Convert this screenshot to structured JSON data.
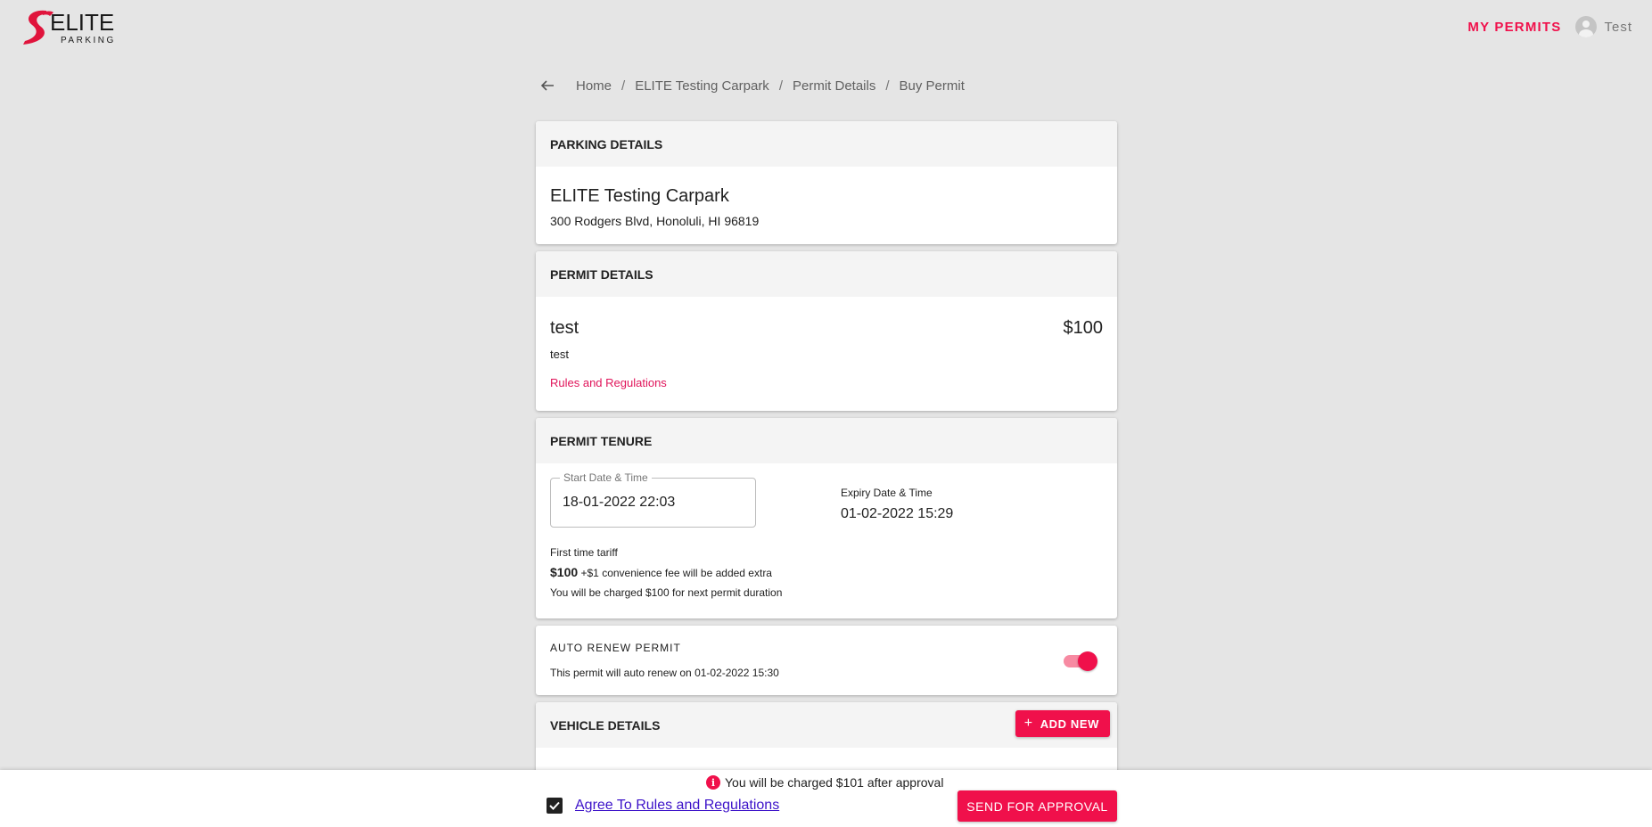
{
  "brand": {
    "logo_word": "ELITE",
    "logo_sub": "PARKING",
    "accent": "#f0104b"
  },
  "header": {
    "nav_link": "MY PERMITS",
    "user_name": "Test",
    "user_icon": "account-circle-icon"
  },
  "breadcrumb": {
    "items": [
      "Home",
      "ELITE Testing Carpark",
      "Permit Details",
      "Buy Permit"
    ],
    "separator": "/"
  },
  "parking": {
    "heading": "PARKING DETAILS",
    "name": "ELITE Testing Carpark",
    "address": "300 Rodgers Blvd, Honoluli, HI 96819"
  },
  "permit": {
    "heading": "PERMIT DETAILS",
    "name": "test",
    "price": "$100",
    "description": "test",
    "rules_link": "Rules and Regulations"
  },
  "tenure": {
    "heading": "PERMIT TENURE",
    "start_label": "Start Date & Time",
    "start_value": "18-01-2022 22:03",
    "expiry_label": "Expiry Date & Time",
    "expiry_value": "01-02-2022 15:29",
    "tariff_label": "First time tariff",
    "tariff_amount": "$100",
    "tariff_fee": "+$1 convenience fee will be added extra",
    "tariff_note": "You will be charged $100 for next permit duration"
  },
  "auto_renew": {
    "title": "AUTO RENEW PERMIT",
    "subtitle": "This permit will auto renew on 01-02-2022 15:30",
    "enabled": true
  },
  "vehicle": {
    "heading": "VEHICLE DETAILS",
    "add_label": "ADD NEW"
  },
  "footer": {
    "charge_note": "You will be charged $101 after approval",
    "agree_label": "Agree To Rules and Regulations",
    "agree_checked": true,
    "submit_label": "SEND FOR APPROVAL"
  }
}
